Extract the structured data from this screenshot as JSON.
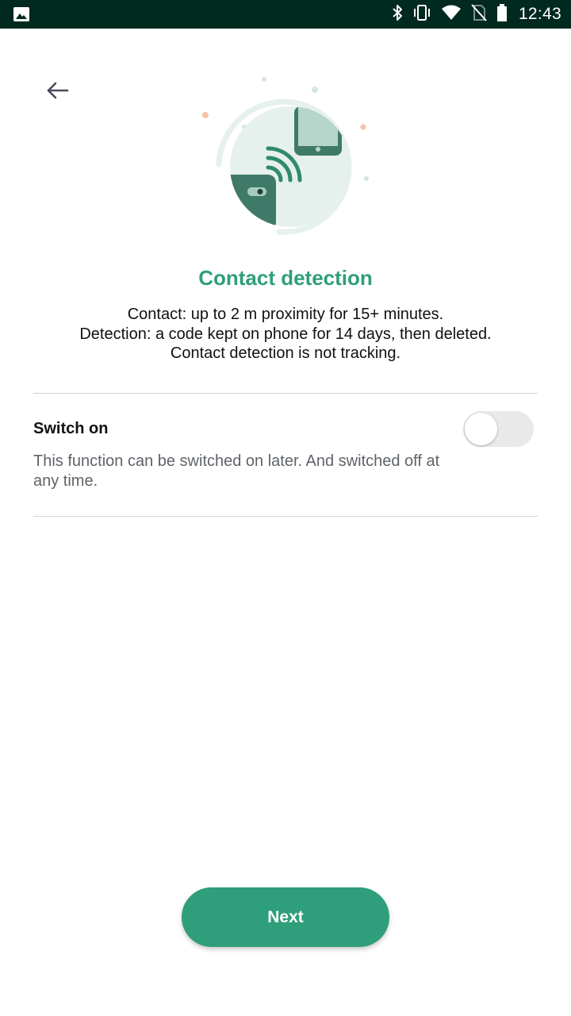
{
  "status_bar": {
    "time": "12:43",
    "icons": [
      "gallery-icon",
      "bluetooth-icon",
      "vibrate-icon",
      "wifi-icon",
      "no-sim-icon",
      "battery-icon"
    ]
  },
  "header": {
    "back_icon": "arrow-left-icon"
  },
  "illustration": {
    "icon": "contact-detection-illustration"
  },
  "title": "Contact detection",
  "description": {
    "line1": "Contact: up to 2 m proximity for 15+ minutes.",
    "line2": "Detection: a code kept on phone for 14 days, then deleted.",
    "line3": "Contact detection is not tracking."
  },
  "switch": {
    "label": "Switch on",
    "hint": "This function can be switched on later. And switched off at any time.",
    "state": "off"
  },
  "footer": {
    "next_label": "Next"
  },
  "colors": {
    "status_bar": "#00291f",
    "accent": "#2f9e7b",
    "divider": "#d3d3d3",
    "toggle_track": "#e9e9e9"
  }
}
